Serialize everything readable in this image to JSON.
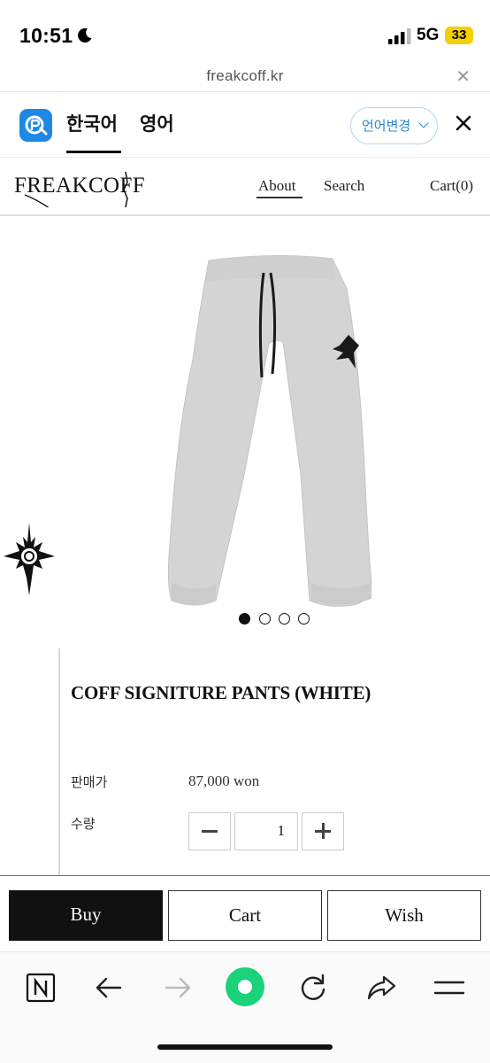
{
  "status_bar": {
    "time": "10:51",
    "network": "5G",
    "battery": "33",
    "moon_icon": "moon-icon",
    "signal_icon": "signal-bars-icon"
  },
  "browser": {
    "url": "freakcoff.kr",
    "close_icon": "close-icon"
  },
  "translate_bar": {
    "app_icon": "papago-icon",
    "tabs": [
      {
        "label": "한국어",
        "active": true
      },
      {
        "label": "영어",
        "active": false
      }
    ],
    "change_label": "언어변경",
    "close_icon": "close-icon",
    "accent_color": "#2a86d9"
  },
  "site": {
    "logo_text": "FREAKCOFF",
    "nav": {
      "about": "About",
      "search": "Search",
      "cart": "Cart(0)"
    }
  },
  "carousel": {
    "total": 4,
    "active_index": 0
  },
  "product": {
    "title": "COFF SIGNITURE PANTS (WHITE)",
    "price_label": "판매가",
    "price_value": "87,000 won",
    "quantity_label": "수량",
    "quantity_value": "1"
  },
  "actions": {
    "buy": "Buy",
    "cart": "Cart",
    "wish": "Wish"
  },
  "toolbar": {
    "icons": [
      "naver-icon",
      "back-arrow-icon",
      "forward-arrow-icon",
      "green-home-icon",
      "refresh-icon",
      "share-icon",
      "menu-icon"
    ],
    "accent_color": "#19d27a"
  }
}
